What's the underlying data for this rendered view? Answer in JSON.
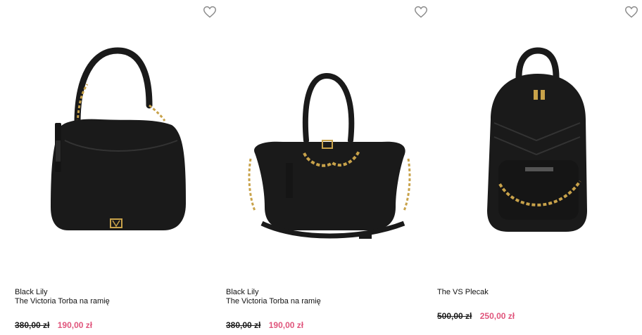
{
  "products": [
    {
      "brand": "Black Lily",
      "name": "The Victoria Torba na ramię",
      "old_price": "380,00 zł",
      "new_price": "190,00 zł",
      "image_icon": "hobo-shoulder-bag",
      "wishlist_icon": "heart-outline-icon"
    },
    {
      "brand": "Black Lily",
      "name": "The Victoria Torba na ramię",
      "old_price": "380,00 zł",
      "new_price": "190,00 zł",
      "image_icon": "satchel-handbag",
      "wishlist_icon": "heart-outline-icon"
    },
    {
      "brand": "",
      "name": "The VS Plecak",
      "old_price": "500,00 zł",
      "new_price": "250,00 zł",
      "image_icon": "backpack",
      "wishlist_icon": "heart-outline-icon"
    }
  ],
  "colors": {
    "sale_price": "#e0557c",
    "bag": "#1a1a1a",
    "hardware_gold": "#c8a24a"
  }
}
